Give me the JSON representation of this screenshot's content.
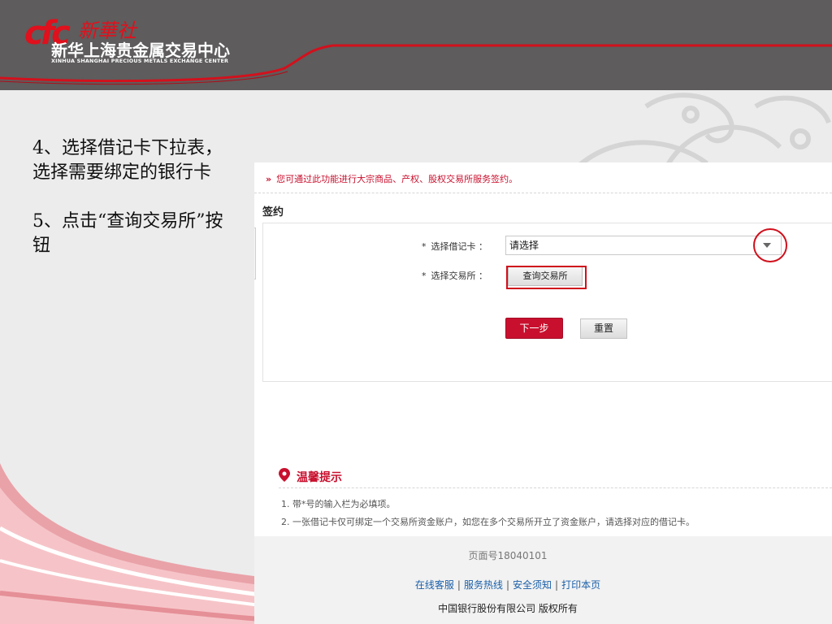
{
  "header": {
    "logo_mark": "cfc",
    "logo_script": "新華社",
    "logo_cn": "新华上海贵金属交易中心",
    "logo_en": "XINHUA SHANGHAI PRECIOUS METALS EXCHANGE CENTER"
  },
  "instructions": {
    "step4": "4、选择借记卡下拉表，选择需要绑定的银行卡",
    "step5": "5、点击“查询交易所”按钮"
  },
  "panel": {
    "notice_arrow": "»",
    "notice": "您可通过此功能进行大宗商品、产权、股权交易所服务签约。",
    "section_title": "签约",
    "form": {
      "star": "*",
      "card_label": "选择借记卡 ：",
      "card_value": "请选择",
      "exchange_label": "选择交易所 ：",
      "query_button": "查询交易所",
      "next_button": "下一步",
      "reset_button": "重置"
    },
    "tips": {
      "title": "温馨提示",
      "items": [
        "1. 带*号的输入栏为必填项。",
        "2. 一张借记卡仅可绑定一个交易所资金账户，如您在多个交易所开立了资金账户，请选择对应的借记卡。"
      ]
    },
    "footer": {
      "page_no": "页面号18040101",
      "links": [
        "在线客服",
        "服务热线",
        "安全须知",
        "打印本页"
      ],
      "separator": "|",
      "copyright": "中国银行股份有限公司  版权所有"
    }
  },
  "colors": {
    "brand_red": "#c8102e",
    "header_gray": "#5e5c5c",
    "highlight_red": "#d0101c",
    "link_blue": "#1a5fa8"
  }
}
